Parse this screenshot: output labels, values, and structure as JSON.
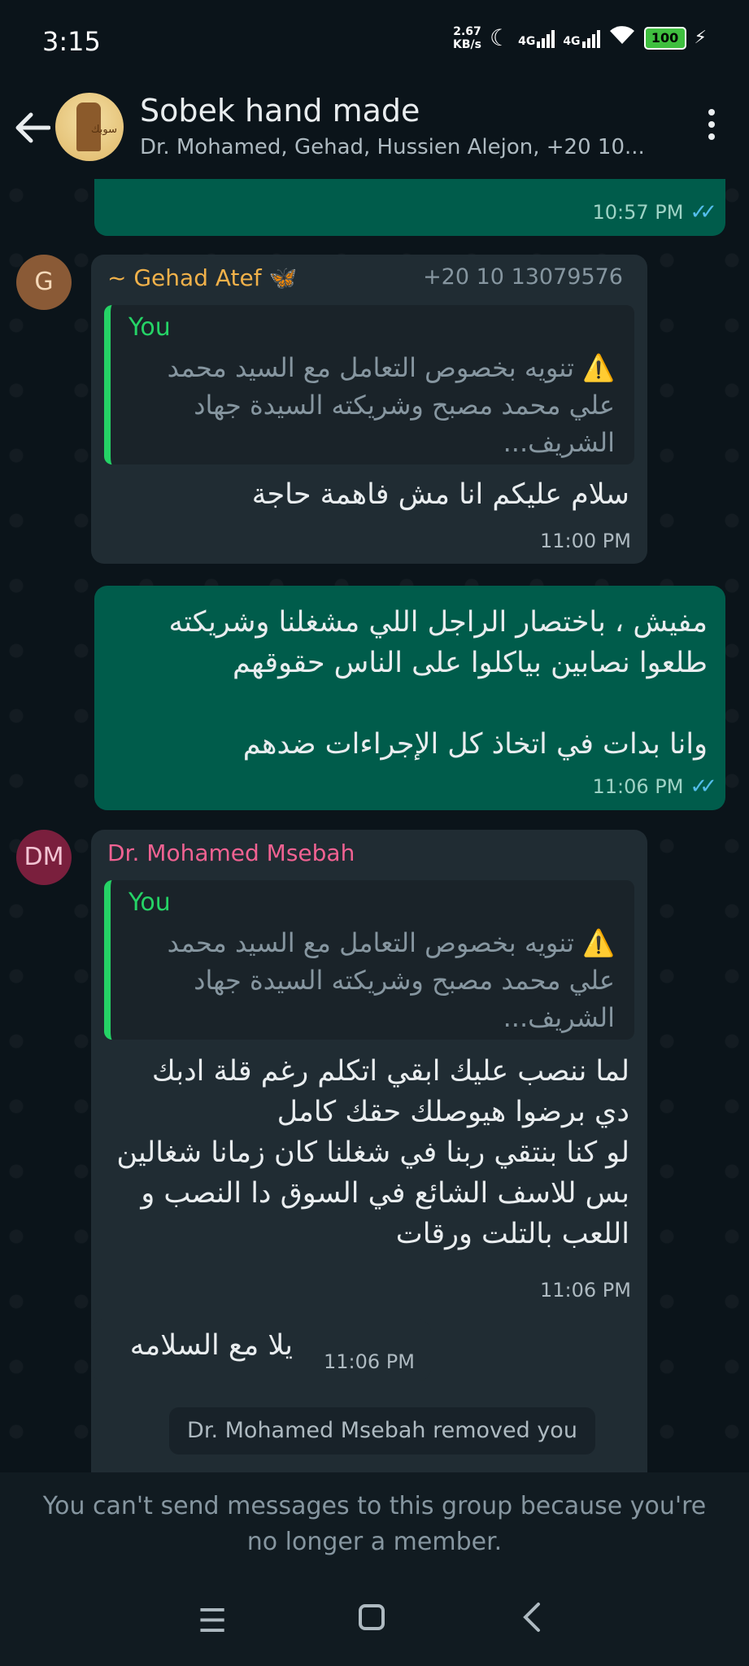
{
  "status": {
    "time": "3:15",
    "net_speed_value": "2.67",
    "net_speed_unit": "KB/s",
    "sim1_label": "4G",
    "sim2_label": "4G",
    "battery": "100"
  },
  "header": {
    "title": "Sobek hand made",
    "subtitle": "Dr. Mohamed, Gehad, Hussien Alejon, +20 10...",
    "avatar_text": "سوبك"
  },
  "messages": {
    "m1": {
      "time": "10:57 PM"
    },
    "m2": {
      "avatar_initial": "G",
      "sender": "~ Gehad Atef 🦋",
      "phone": "+20 10 13079576",
      "quote_name": "You",
      "quote_text": "تنويه بخصوص التعامل مع السيد محمد علي محمد مصبح وشريكته السيدة جهاد الشريف...",
      "quote_icon": "warning-icon",
      "text": "سلام عليكم انا مش فاهمة حاجة",
      "time": "11:00 PM"
    },
    "m3": {
      "text": "مفيش ، باختصار الراجل اللي مشغلنا وشريكته طلعوا نصابين بياكلوا على الناس حقوقهم\n\nوانا بدات في اتخاذ كل الإجراءات ضدهم",
      "time": "11:06 PM"
    },
    "m4": {
      "avatar_initial": "DM",
      "sender": "Dr. Mohamed Msebah",
      "quote_name": "You",
      "quote_text": "تنويه بخصوص التعامل مع السيد محمد علي محمد مصبح وشريكته السيدة جهاد الشريف...",
      "quote_icon": "warning-icon",
      "text": "لما ننصب عليك ابقي اتكلم رغم قلة ادبك دي برضوا هيوصلك حقك كامل\nلو كنا بنتقي ربنا في شغلنا كان زمانا شغالين بس للاسف الشائع في السوق دا النصب و اللعب بالتلت ورقات",
      "time": "11:06 PM"
    },
    "m5": {
      "text": "يلا مع السلامه",
      "time": "11:06 PM"
    }
  },
  "system_message": "Dr. Mohamed Msebah removed you",
  "footer_notice": "You can't send messages to this group because you're no longer a member.",
  "colors": {
    "outgoing_bubble": "#005c4b",
    "incoming_bubble": "#202c33",
    "accent_green": "#25d366",
    "read_ticks": "#53bdeb",
    "gehad_name": "#f0b14a",
    "mohamed_name": "#f06292"
  }
}
